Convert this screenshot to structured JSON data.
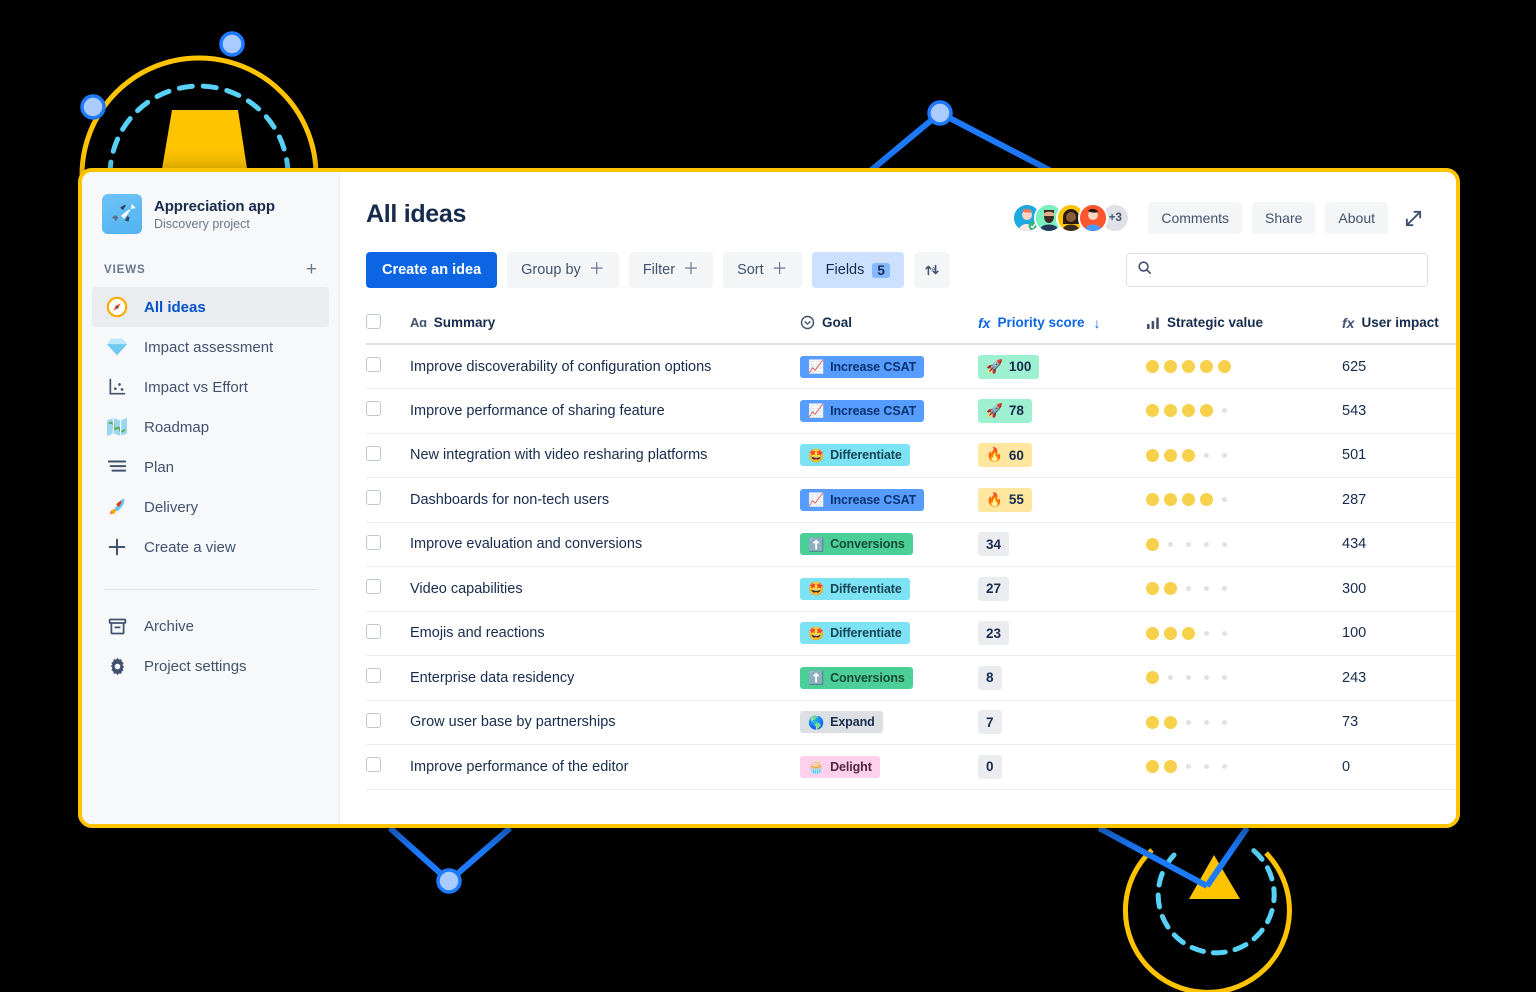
{
  "theme": {
    "background": "#000000",
    "window_border": "#FFC400",
    "accent_blue": "#0C66E4",
    "deco_yellow": "#FFC400",
    "deco_cyan": "#57D1F5",
    "deco_blue": "#1D7AFC",
    "deco_node": "#A9CBFF"
  },
  "sidebar": {
    "project": {
      "name": "Appreciation app",
      "subtitle": "Discovery project",
      "avatar_icon": "rocket-plane-icon"
    },
    "views_label": "VIEWS",
    "add_view_icon": "plus-icon",
    "items": [
      {
        "label": "All ideas",
        "icon": "compass-icon",
        "emoji": "🧭",
        "active": true
      },
      {
        "label": "Impact assessment",
        "icon": "gem-icon",
        "emoji": "💎",
        "active": false
      },
      {
        "label": "Impact vs Effort",
        "icon": "chart-icon",
        "emoji": "📉",
        "active": false
      },
      {
        "label": "Roadmap",
        "icon": "map-icon",
        "emoji": "🗺️",
        "active": false
      },
      {
        "label": "Plan",
        "icon": "list-icon",
        "emoji": "☰",
        "active": false
      },
      {
        "label": "Delivery",
        "icon": "rocket-icon",
        "emoji": "🚀",
        "active": false
      },
      {
        "label": "Create a view",
        "icon": "plus-icon",
        "emoji": "＋",
        "active": false
      }
    ],
    "bottom_items": [
      {
        "label": "Archive",
        "icon": "archive-icon"
      },
      {
        "label": "Project settings",
        "icon": "gear-icon"
      }
    ]
  },
  "header": {
    "title": "All ideas",
    "avatars": [
      {
        "name": "avatar-1",
        "bg": "#1FA9E3",
        "emoji": "👩"
      },
      {
        "name": "avatar-2",
        "bg": "#36B37E",
        "emoji": "🗿"
      },
      {
        "name": "avatar-3",
        "bg": "#FFC400",
        "emoji": "👩🏿"
      },
      {
        "name": "avatar-4",
        "bg": "#FF5630",
        "emoji": "👨"
      }
    ],
    "avatar_overflow": "+3",
    "buttons": [
      {
        "label": "Comments",
        "name": "comments-button"
      },
      {
        "label": "Share",
        "name": "share-button"
      },
      {
        "label": "About",
        "name": "about-button"
      }
    ],
    "expand_icon": "expand-arrows-icon"
  },
  "toolbar": {
    "create_label": "Create an idea",
    "group_by_label": "Group by",
    "filter_label": "Filter",
    "sort_label": "Sort",
    "plus_glyph": "＋",
    "fields_label": "Fields",
    "fields_count": "5",
    "sort_toggle_icon": "sort-alpha-icon",
    "search_placeholder": "",
    "search_value": "",
    "search_icon": "search-icon"
  },
  "table": {
    "columns": [
      {
        "key": "check",
        "label": "",
        "icon": "checkbox-icon"
      },
      {
        "key": "summary",
        "label": "Summary",
        "icon": "text-aa-icon"
      },
      {
        "key": "goal",
        "label": "Goal",
        "icon": "target-icon"
      },
      {
        "key": "score",
        "label": "Priority score",
        "icon": "formula-icon",
        "sorted": true,
        "sort_glyph": "↓"
      },
      {
        "key": "strat",
        "label": "Strategic value",
        "icon": "bar-chart-icon"
      },
      {
        "key": "impact",
        "label": "User impact",
        "icon": "formula-icon"
      }
    ],
    "rows": [
      {
        "summary": "Improve discoverability of configuration options",
        "goal": "Increase CSAT",
        "goal_emoji": "📈",
        "goal_bg": "#579DFF",
        "goal_fg": "#09326C",
        "score": "100",
        "score_style": "top",
        "score_emoji": "🚀",
        "strategic": 5,
        "impact": "625"
      },
      {
        "summary": "Improve performance of sharing feature",
        "goal": "Increase CSAT",
        "goal_emoji": "📈",
        "goal_bg": "#579DFF",
        "goal_fg": "#09326C",
        "score": "78",
        "score_style": "top",
        "score_emoji": "🚀",
        "strategic": 4,
        "impact": "543"
      },
      {
        "summary": "New integration with video resharing platforms",
        "goal": "Differentiate",
        "goal_emoji": "🤩",
        "goal_bg": "#7EE2F5",
        "goal_fg": "#164555",
        "score": "60",
        "score_style": "hot",
        "score_emoji": "🔥",
        "strategic": 3,
        "impact": "501"
      },
      {
        "summary": "Dashboards for non-tech users",
        "goal": "Increase CSAT",
        "goal_emoji": "📈",
        "goal_bg": "#579DFF",
        "goal_fg": "#09326C",
        "score": "55",
        "score_style": "hot",
        "score_emoji": "🔥",
        "strategic": 4,
        "impact": "287"
      },
      {
        "summary": "Improve evaluation and conversions",
        "goal": "Conversions",
        "goal_emoji": "⬆️",
        "goal_bg": "#4BCE97",
        "goal_fg": "#164B35",
        "score": "34",
        "score_style": "plain",
        "score_emoji": "",
        "strategic": 1,
        "impact": "434"
      },
      {
        "summary": "Video capabilities",
        "goal": "Differentiate",
        "goal_emoji": "🤩",
        "goal_bg": "#7EE2F5",
        "goal_fg": "#164555",
        "score": "27",
        "score_style": "plain",
        "score_emoji": "",
        "strategic": 2,
        "impact": "300"
      },
      {
        "summary": "Emojis and reactions",
        "goal": "Differentiate",
        "goal_emoji": "🤩",
        "goal_bg": "#7EE2F5",
        "goal_fg": "#164555",
        "score": "23",
        "score_style": "plain",
        "score_emoji": "",
        "strategic": 3,
        "impact": "100"
      },
      {
        "summary": "Enterprise data residency",
        "goal": "Conversions",
        "goal_emoji": "⬆️",
        "goal_bg": "#4BCE97",
        "goal_fg": "#164B35",
        "score": "8",
        "score_style": "plain",
        "score_emoji": "",
        "strategic": 1,
        "impact": "243"
      },
      {
        "summary": "Grow user base by partnerships",
        "goal": "Expand",
        "goal_emoji": "🌎",
        "goal_bg": "#DCDFE4",
        "goal_fg": "#172B4D",
        "score": "7",
        "score_style": "plain",
        "score_emoji": "",
        "strategic": 2,
        "impact": "73"
      },
      {
        "summary": "Improve performance of the editor",
        "goal": "Delight",
        "goal_emoji": "🧁",
        "goal_bg": "#FDD0EC",
        "goal_fg": "#50253F",
        "score": "0",
        "score_style": "plain",
        "score_emoji": "",
        "strategic": 2,
        "impact": "0"
      }
    ],
    "strategic_max": 5
  }
}
